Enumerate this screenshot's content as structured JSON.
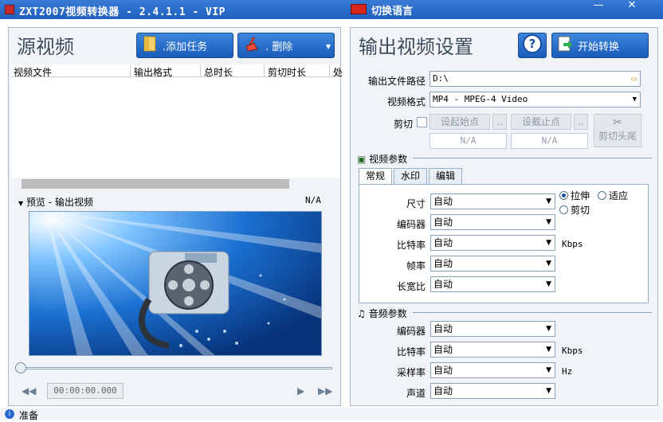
{
  "window": {
    "title": "ZXT2007视频转换器 - 2.4.1.1 - VIP",
    "language_button": "切换语言",
    "minimize": "—",
    "close": "✕"
  },
  "left": {
    "title": "源视频",
    "add_task": ".添加任务",
    "delete": ". 删除",
    "columns": [
      "视频文件",
      "输出格式",
      "总时长",
      "剪切时长",
      "处"
    ],
    "preview_label": "预览 - 输出视频",
    "preview_value": "N/A",
    "timecode": "00:00:00.000"
  },
  "right": {
    "title": "输出视频设置",
    "start": "开始转换",
    "output_path_label": "输出文件路径",
    "output_path": "D:\\",
    "format_label": "视频格式",
    "format_value": "MP4 - MPEG-4 Video",
    "cut_label": "剪切",
    "set_start": "设起始点",
    "set_end": "设截止点",
    "start_value": "N/A",
    "end_value": "N/A",
    "cut_head_tail": "剪切头尾",
    "ellipsis": "..",
    "video_params": "视频参数",
    "tabs": [
      "常规",
      "水印",
      "编辑"
    ],
    "video": {
      "size_label": "尺寸",
      "size": "自动",
      "encoder_label": "编码器",
      "encoder": "自动",
      "bitrate_label": "比特率",
      "bitrate": "自动",
      "bitrate_unit": "Kbps",
      "fps_label": "帧率",
      "fps": "自动",
      "aspect_label": "长宽比",
      "aspect": "自动",
      "stretch": "拉伸",
      "fit": "适应",
      "crop": "剪切"
    },
    "audio_params": "音频参数",
    "audio": {
      "encoder_label": "编码器",
      "encoder": "自动",
      "bitrate_label": "比特率",
      "bitrate": "自动",
      "bitrate_unit": "Kbps",
      "samplerate_label": "采样率",
      "samplerate": "自动",
      "samplerate_unit": "Hz",
      "channels_label": "声道",
      "channels": "自动"
    }
  },
  "status": {
    "text": "准备"
  }
}
